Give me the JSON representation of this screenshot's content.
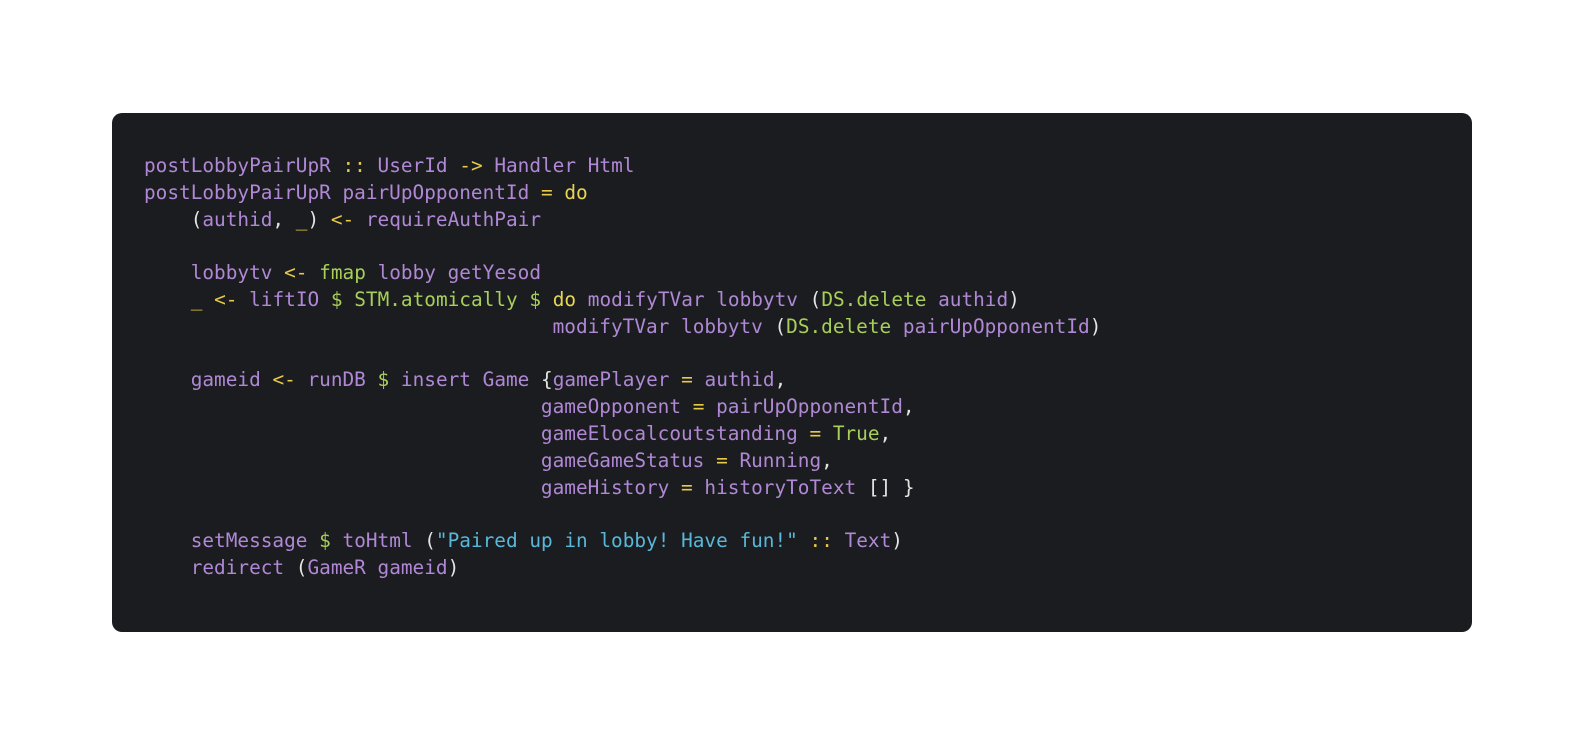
{
  "code": {
    "language": "haskell",
    "lines": [
      [
        {
          "t": "postLobbyPairUpR",
          "k": "ident"
        },
        {
          "t": " ",
          "k": "punct"
        },
        {
          "t": "::",
          "k": "op"
        },
        {
          "t": " ",
          "k": "punct"
        },
        {
          "t": "UserId",
          "k": "ident"
        },
        {
          "t": " ",
          "k": "punct"
        },
        {
          "t": "->",
          "k": "op"
        },
        {
          "t": " ",
          "k": "punct"
        },
        {
          "t": "Handler",
          "k": "ident"
        },
        {
          "t": " ",
          "k": "punct"
        },
        {
          "t": "Html",
          "k": "ident"
        }
      ],
      [
        {
          "t": "postLobbyPairUpR",
          "k": "ident"
        },
        {
          "t": " ",
          "k": "punct"
        },
        {
          "t": "pairUpOpponentId",
          "k": "ident"
        },
        {
          "t": " ",
          "k": "punct"
        },
        {
          "t": "=",
          "k": "op"
        },
        {
          "t": " ",
          "k": "punct"
        },
        {
          "t": "do",
          "k": "kw"
        }
      ],
      [
        {
          "t": "    (",
          "k": "punct"
        },
        {
          "t": "authid",
          "k": "ident"
        },
        {
          "t": ", ",
          "k": "punct"
        },
        {
          "t": "_",
          "k": "op"
        },
        {
          "t": ") ",
          "k": "punct"
        },
        {
          "t": "<-",
          "k": "op"
        },
        {
          "t": " ",
          "k": "punct"
        },
        {
          "t": "requireAuthPair",
          "k": "ident"
        }
      ],
      [],
      [
        {
          "t": "    ",
          "k": "punct"
        },
        {
          "t": "lobbytv",
          "k": "ident"
        },
        {
          "t": " ",
          "k": "punct"
        },
        {
          "t": "<-",
          "k": "op"
        },
        {
          "t": " ",
          "k": "punct"
        },
        {
          "t": "fmap",
          "k": "fn"
        },
        {
          "t": " ",
          "k": "punct"
        },
        {
          "t": "lobby",
          "k": "ident"
        },
        {
          "t": " ",
          "k": "punct"
        },
        {
          "t": "getYesod",
          "k": "ident"
        }
      ],
      [
        {
          "t": "    ",
          "k": "punct"
        },
        {
          "t": "_",
          "k": "op"
        },
        {
          "t": " ",
          "k": "punct"
        },
        {
          "t": "<-",
          "k": "op"
        },
        {
          "t": " ",
          "k": "punct"
        },
        {
          "t": "liftIO",
          "k": "ident"
        },
        {
          "t": " ",
          "k": "punct"
        },
        {
          "t": "$",
          "k": "fn"
        },
        {
          "t": " ",
          "k": "punct"
        },
        {
          "t": "STM.atomically",
          "k": "con"
        },
        {
          "t": " ",
          "k": "punct"
        },
        {
          "t": "$",
          "k": "fn"
        },
        {
          "t": " ",
          "k": "punct"
        },
        {
          "t": "do",
          "k": "kw"
        },
        {
          "t": " ",
          "k": "punct"
        },
        {
          "t": "modifyTVar",
          "k": "ident"
        },
        {
          "t": " ",
          "k": "punct"
        },
        {
          "t": "lobbytv",
          "k": "ident"
        },
        {
          "t": " (",
          "k": "punct"
        },
        {
          "t": "DS.delete",
          "k": "con"
        },
        {
          "t": " ",
          "k": "punct"
        },
        {
          "t": "authid",
          "k": "ident"
        },
        {
          "t": ")",
          "k": "punct"
        }
      ],
      [
        {
          "t": "                                   ",
          "k": "punct"
        },
        {
          "t": "modifyTVar",
          "k": "ident"
        },
        {
          "t": " ",
          "k": "punct"
        },
        {
          "t": "lobbytv",
          "k": "ident"
        },
        {
          "t": " (",
          "k": "punct"
        },
        {
          "t": "DS.delete",
          "k": "con"
        },
        {
          "t": " ",
          "k": "punct"
        },
        {
          "t": "pairUpOpponentId",
          "k": "ident"
        },
        {
          "t": ")",
          "k": "punct"
        }
      ],
      [],
      [
        {
          "t": "    ",
          "k": "punct"
        },
        {
          "t": "gameid",
          "k": "ident"
        },
        {
          "t": " ",
          "k": "punct"
        },
        {
          "t": "<-",
          "k": "op"
        },
        {
          "t": " ",
          "k": "punct"
        },
        {
          "t": "runDB",
          "k": "ident"
        },
        {
          "t": " ",
          "k": "punct"
        },
        {
          "t": "$",
          "k": "fn"
        },
        {
          "t": " ",
          "k": "punct"
        },
        {
          "t": "insert",
          "k": "ident"
        },
        {
          "t": " ",
          "k": "punct"
        },
        {
          "t": "Game",
          "k": "ident"
        },
        {
          "t": " {",
          "k": "punct"
        },
        {
          "t": "gamePlayer",
          "k": "ident"
        },
        {
          "t": " ",
          "k": "punct"
        },
        {
          "t": "=",
          "k": "op"
        },
        {
          "t": " ",
          "k": "punct"
        },
        {
          "t": "authid",
          "k": "ident"
        },
        {
          "t": ",",
          "k": "punct"
        }
      ],
      [
        {
          "t": "                                  ",
          "k": "punct"
        },
        {
          "t": "gameOpponent",
          "k": "ident"
        },
        {
          "t": " ",
          "k": "punct"
        },
        {
          "t": "=",
          "k": "op"
        },
        {
          "t": " ",
          "k": "punct"
        },
        {
          "t": "pairUpOpponentId",
          "k": "ident"
        },
        {
          "t": ",",
          "k": "punct"
        }
      ],
      [
        {
          "t": "                                  ",
          "k": "punct"
        },
        {
          "t": "gameElocalcoutstanding",
          "k": "ident"
        },
        {
          "t": " ",
          "k": "punct"
        },
        {
          "t": "=",
          "k": "op"
        },
        {
          "t": " ",
          "k": "punct"
        },
        {
          "t": "True",
          "k": "con"
        },
        {
          "t": ",",
          "k": "punct"
        }
      ],
      [
        {
          "t": "                                  ",
          "k": "punct"
        },
        {
          "t": "gameGameStatus",
          "k": "ident"
        },
        {
          "t": " ",
          "k": "punct"
        },
        {
          "t": "=",
          "k": "op"
        },
        {
          "t": " ",
          "k": "punct"
        },
        {
          "t": "Running",
          "k": "ident"
        },
        {
          "t": ",",
          "k": "punct"
        }
      ],
      [
        {
          "t": "                                  ",
          "k": "punct"
        },
        {
          "t": "gameHistory",
          "k": "ident"
        },
        {
          "t": " ",
          "k": "punct"
        },
        {
          "t": "=",
          "k": "op"
        },
        {
          "t": " ",
          "k": "punct"
        },
        {
          "t": "historyToText",
          "k": "ident"
        },
        {
          "t": " [] }",
          "k": "punct"
        }
      ],
      [],
      [
        {
          "t": "    ",
          "k": "punct"
        },
        {
          "t": "setMessage",
          "k": "ident"
        },
        {
          "t": " ",
          "k": "punct"
        },
        {
          "t": "$",
          "k": "fn"
        },
        {
          "t": " ",
          "k": "punct"
        },
        {
          "t": "toHtml",
          "k": "ident"
        },
        {
          "t": " (",
          "k": "punct"
        },
        {
          "t": "\"Paired up in lobby! Have fun!\"",
          "k": "str"
        },
        {
          "t": " ",
          "k": "punct"
        },
        {
          "t": "::",
          "k": "op"
        },
        {
          "t": " ",
          "k": "punct"
        },
        {
          "t": "Text",
          "k": "ident"
        },
        {
          "t": ")",
          "k": "punct"
        }
      ],
      [
        {
          "t": "    ",
          "k": "punct"
        },
        {
          "t": "redirect",
          "k": "ident"
        },
        {
          "t": " (",
          "k": "punct"
        },
        {
          "t": "GameR",
          "k": "ident"
        },
        {
          "t": " ",
          "k": "punct"
        },
        {
          "t": "gameid",
          "k": "ident"
        },
        {
          "t": ")",
          "k": "punct"
        }
      ]
    ]
  },
  "colors": {
    "page_background": "#ffffff",
    "panel_background": "#1b1c1f",
    "identifier": "#b088d6",
    "operator": "#e8c94a",
    "keyword": "#e8d653",
    "function": "#a7cf59",
    "string": "#58b8da",
    "constructor": "#a7cf59",
    "punctuation": "#e4e4e4"
  }
}
